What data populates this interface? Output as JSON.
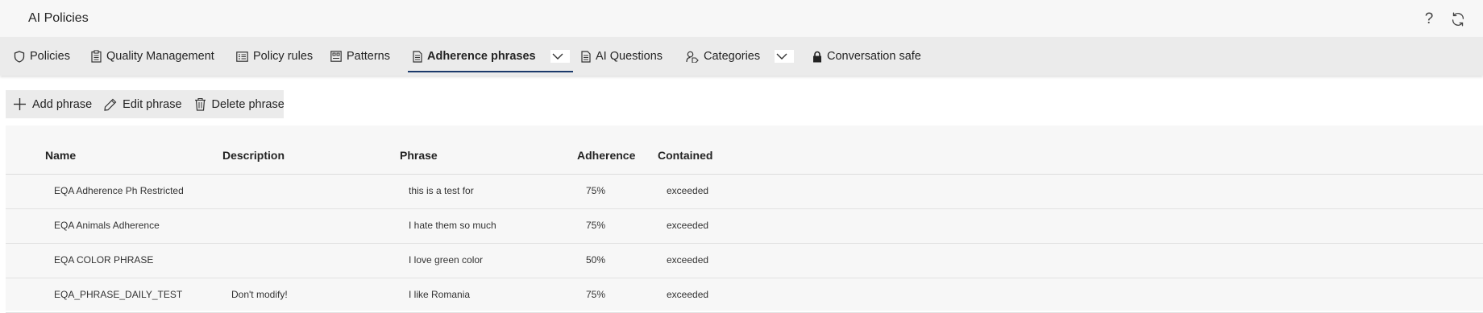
{
  "app": {
    "title": "AI Policies"
  },
  "header_icons": {
    "help": "?",
    "refresh": "refresh-icon"
  },
  "tabs": [
    {
      "label": "Policies",
      "icon": "shield-icon"
    },
    {
      "label": "Quality Management",
      "icon": "clipboard-icon"
    },
    {
      "label": "Policy rules",
      "icon": "rules-icon"
    },
    {
      "label": "Patterns",
      "icon": "pattern-icon"
    },
    {
      "label": "Adherence phrases",
      "icon": "document-icon",
      "active": true,
      "dropdown": true
    },
    {
      "label": "AI Questions",
      "icon": "document-icon"
    },
    {
      "label": "Categories",
      "icon": "person-tag-icon",
      "dropdown": true
    },
    {
      "label": "Conversation safe",
      "icon": "lock-icon"
    }
  ],
  "toolbar": {
    "add_label": "Add phrase",
    "edit_label": "Edit phrase",
    "delete_label": "Delete phrase"
  },
  "table": {
    "columns": [
      "Name",
      "Description",
      "Phrase",
      "Adherence",
      "Contained"
    ],
    "rows": [
      {
        "name": "EQA Adherence Ph Restricted",
        "description": "",
        "phrase": "this is a test for",
        "adherence": "75%",
        "contained": "exceeded"
      },
      {
        "name": "EQA Animals Adherence",
        "description": "",
        "phrase": "I hate them so much",
        "adherence": "75%",
        "contained": "exceeded"
      },
      {
        "name": "EQA COLOR PHRASE",
        "description": "",
        "phrase": "I love green color",
        "adherence": "50%",
        "contained": "exceeded"
      },
      {
        "name": "EQA_PHRASE_DAILY_TEST",
        "description": "Don't modify!",
        "phrase": "I like Romania",
        "adherence": "75%",
        "contained": "exceeded"
      }
    ]
  },
  "colors": {
    "accent": "#1b3a6b",
    "tabbar_bg": "#ebebeb",
    "grid_bg": "#f7f7f7"
  }
}
